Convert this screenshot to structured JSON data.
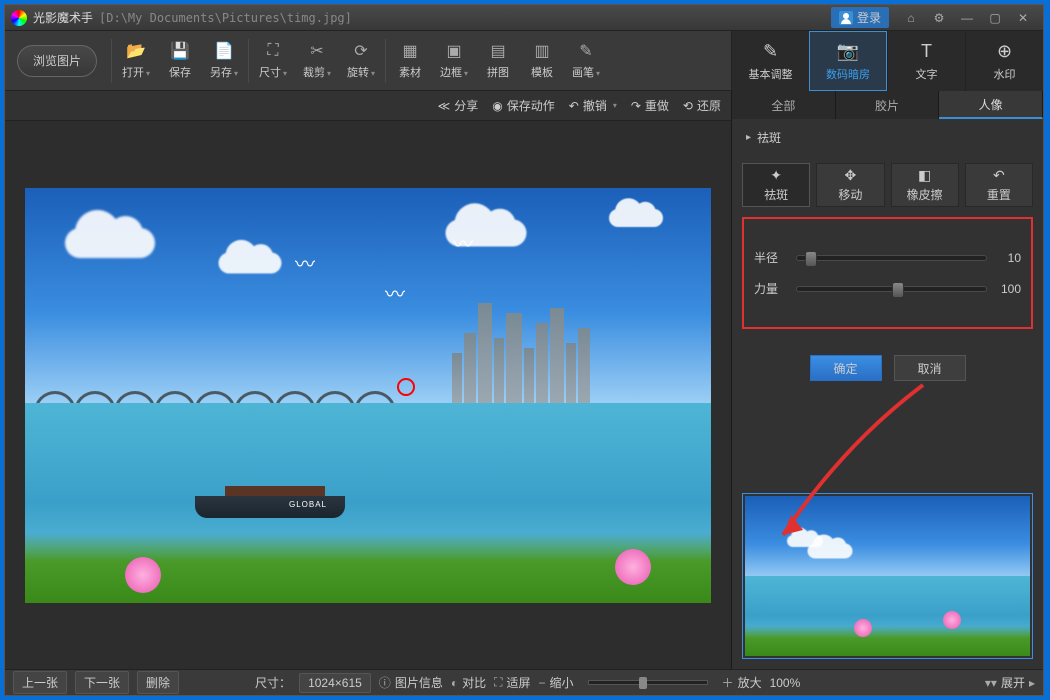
{
  "title": {
    "app": "光影魔术手",
    "path": "[D:\\My Documents\\Pictures\\timg.jpg]",
    "login": "登录"
  },
  "browse": "浏览图片",
  "toolbar": [
    {
      "label": "打开",
      "icon": "📂",
      "dd": true
    },
    {
      "label": "保存",
      "icon": "💾"
    },
    {
      "label": "另存",
      "icon": "📄",
      "dd": true,
      "sep": true
    },
    {
      "label": "尺寸",
      "icon": "⛶",
      "dd": true
    },
    {
      "label": "裁剪",
      "icon": "✂",
      "dd": true
    },
    {
      "label": "旋转",
      "icon": "⟳",
      "dd": true,
      "sep": true
    },
    {
      "label": "素材",
      "icon": "▦"
    },
    {
      "label": "边框",
      "icon": "▣",
      "dd": true
    },
    {
      "label": "拼图",
      "icon": "▤"
    },
    {
      "label": "模板",
      "icon": "▥"
    },
    {
      "label": "画笔",
      "icon": "✎",
      "dd": true
    }
  ],
  "rtabs": [
    {
      "label": "基本调整",
      "icon": "✎"
    },
    {
      "label": "数码暗房",
      "icon": "📷",
      "active": true
    },
    {
      "label": "文字",
      "icon": "T"
    },
    {
      "label": "水印",
      "icon": "⊕"
    }
  ],
  "actions": [
    {
      "label": "分享",
      "icon": "≪"
    },
    {
      "label": "保存动作",
      "icon": "◉"
    },
    {
      "label": "撤销",
      "icon": "↶",
      "dd": true
    },
    {
      "label": "重做",
      "icon": "↷"
    },
    {
      "label": "还原",
      "icon": "⟲"
    }
  ],
  "subtabs": [
    {
      "label": "全部"
    },
    {
      "label": "胶片"
    },
    {
      "label": "人像",
      "active": true
    }
  ],
  "section_head": "祛斑",
  "toolgrid": [
    {
      "label": "祛斑",
      "icon": "✦",
      "active": true
    },
    {
      "label": "移动",
      "icon": "✥"
    },
    {
      "label": "橡皮擦",
      "icon": "◧"
    },
    {
      "label": "重置",
      "icon": "↶"
    }
  ],
  "sliders": [
    {
      "label": "半径",
      "val": "10",
      "pos": 4
    },
    {
      "label": "力量",
      "val": "100",
      "pos": 50
    }
  ],
  "buttons": {
    "ok": "确定",
    "cancel": "取消"
  },
  "boat_text": "GLOBAL",
  "status": {
    "prev": "上一张",
    "next": "下一张",
    "del": "删除",
    "size_label": "尺寸：",
    "size": "1024×615",
    "info": "图片信息",
    "compare": "对比",
    "fit": "适屏",
    "zoom_out": "缩小",
    "zoom_in": "放大",
    "zoom_pct": "100%",
    "expand": "展开"
  }
}
